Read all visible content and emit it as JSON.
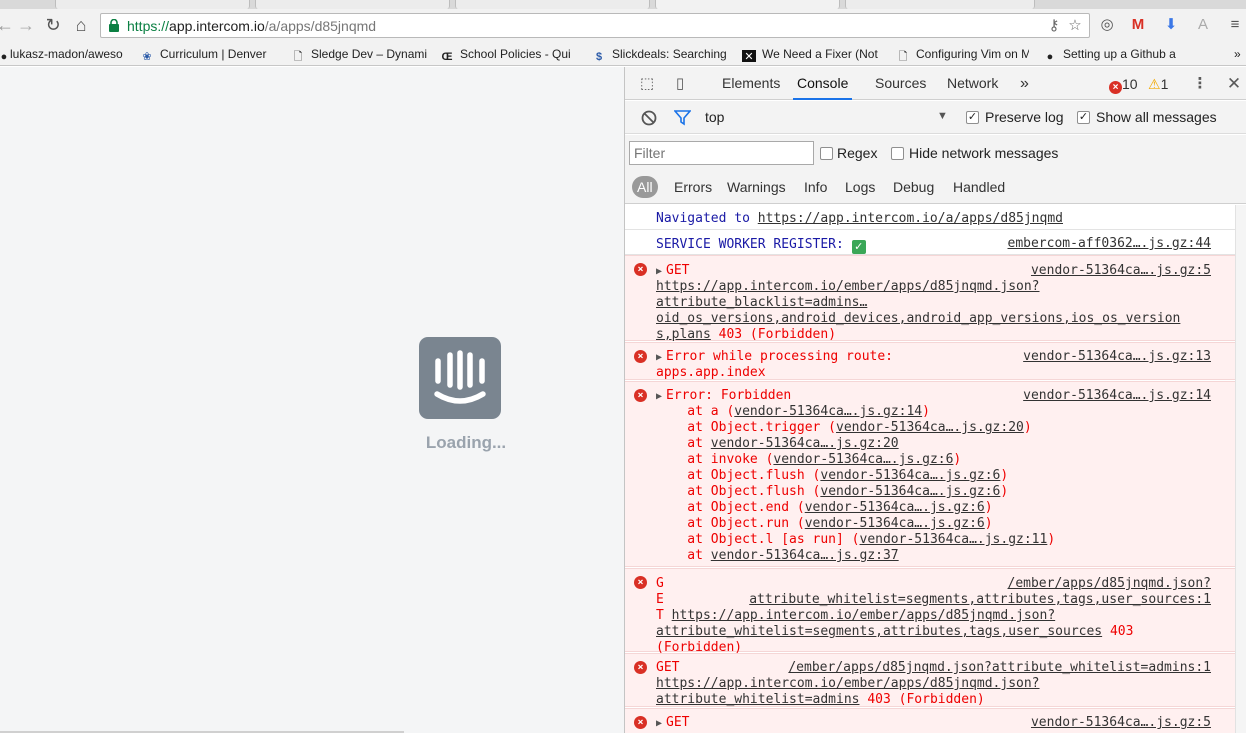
{
  "browser": {
    "url_scheme": "https://",
    "url_host": "app.intercom.io",
    "url_path": "/a/apps/d85jnqmd",
    "bookmarks": [
      {
        "label": "lukasz-madon/aweso"
      },
      {
        "label": "Curriculum | Denver"
      },
      {
        "label": "Sledge Dev – Dynami"
      },
      {
        "label": "School Policies - Qui"
      },
      {
        "label": "Slickdeals: Searching"
      },
      {
        "label": "We Need a Fixer (Not"
      },
      {
        "label": "Configuring Vim on M"
      },
      {
        "label": "Setting up a Github a"
      }
    ]
  },
  "page": {
    "loading_text": "Loading..."
  },
  "devtools": {
    "tabs": [
      "Elements",
      "Console",
      "Sources",
      "Network"
    ],
    "more": "»",
    "error_count": "10",
    "warning_count": "1",
    "context": "top",
    "preserve_log": "Preserve log",
    "show_all": "Show all messages",
    "filter_placeholder": "Filter",
    "regex": "Regex",
    "hide_network": "Hide network messages",
    "levels": [
      "All",
      "Errors",
      "Warnings",
      "Info",
      "Logs",
      "Debug",
      "Handled"
    ]
  },
  "console": {
    "nav_prefix": "Navigated to ",
    "nav_url": "https://app.intercom.io/a/apps/d85jnqmd",
    "sw_text": "SERVICE WORKER REGISTER: ",
    "sw_src": "embercom-aff0362….js.gz:44",
    "e1": {
      "src": "vendor-51364ca….js.gz:5",
      "l0": "GET",
      "l1": "https://app.intercom.io/ember/apps/d85jnqmd.json?",
      "l2": "attribute_blacklist=admins…",
      "l3": "oid_os_versions,android_devices,android_app_versions,ios_os_version",
      "l4a": "s,plans",
      "l4b": " 403 (Forbidden)"
    },
    "e2": {
      "src": "vendor-51364ca….js.gz:13",
      "l0": "Error while processing route:",
      "l1": "apps.app.index"
    },
    "e3": {
      "src": "vendor-51364ca….js.gz:14",
      "l0": "Error: Forbidden",
      "stack": [
        {
          "pre": "    at a (",
          "link": "vendor-51364ca….js.gz:14",
          "post": ")"
        },
        {
          "pre": "    at Object.trigger (",
          "link": "vendor-51364ca….js.gz:20",
          "post": ")"
        },
        {
          "pre": "    at ",
          "link": "vendor-51364ca….js.gz:20",
          "post": ""
        },
        {
          "pre": "    at invoke (",
          "link": "vendor-51364ca….js.gz:6",
          "post": ")"
        },
        {
          "pre": "    at Object.flush (",
          "link": "vendor-51364ca….js.gz:6",
          "post": ")"
        },
        {
          "pre": "    at Object.flush (",
          "link": "vendor-51364ca….js.gz:6",
          "post": ")"
        },
        {
          "pre": "    at Object.end (",
          "link": "vendor-51364ca….js.gz:6",
          "post": ")"
        },
        {
          "pre": "    at Object.run (",
          "link": "vendor-51364ca….js.gz:6",
          "post": ")"
        },
        {
          "pre": "    at Object.l [as run] (",
          "link": "vendor-51364ca….js.gz:11",
          "post": ")"
        },
        {
          "pre": "    at ",
          "link": "vendor-51364ca….js.gz:37",
          "post": ""
        }
      ]
    },
    "e4": {
      "src1": "/ember/apps/d85jnqmd.json?",
      "src2": "attribute_whitelist=segments,attributes,tags,user_sources:1",
      "g": "G",
      "e": "E",
      "t": "T",
      "l2": "https://app.intercom.io/ember/apps/d85jnqmd.json?",
      "l3a": "attribute_whitelist=segments,attributes,tags,user_sources",
      "l3b": " 403",
      "l4": "(Forbidden)"
    },
    "e5": {
      "l0": "GET",
      "src": "/ember/apps/d85jnqmd.json?attribute_whitelist=admins:1",
      "l1": "https://app.intercom.io/ember/apps/d85jnqmd.json?",
      "l2a": "attribute_whitelist=admins",
      "l2b": " 403 (Forbidden)"
    },
    "e6": {
      "l0": "GET",
      "src": "vendor-51364ca….js.gz:5"
    }
  },
  "colors": {
    "error": "#e00000",
    "error_bg": "#fff0f0",
    "accent": "#1a73e8"
  }
}
